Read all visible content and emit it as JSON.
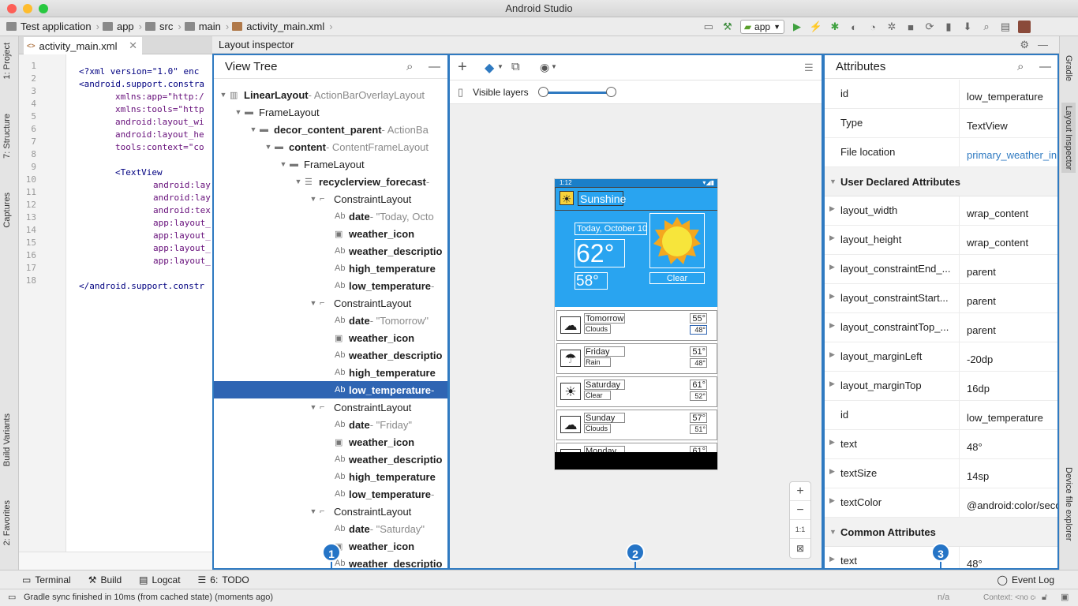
{
  "window": {
    "title": "Android Studio"
  },
  "breadcrumbs": [
    "Test application",
    "app",
    "src",
    "main",
    "activity_main.xml"
  ],
  "run_config": "app",
  "left_tabs": [
    "1: Project",
    "7: Structure",
    "Captures",
    "Build Variants",
    "2: Favorites"
  ],
  "right_tabs": [
    "Gradle",
    "Layout Inspector",
    "Device file explorer"
  ],
  "editor": {
    "tab": "activity_main.xml",
    "line_numbers": [
      "1",
      "2",
      "3",
      "4",
      "5",
      "6",
      "7",
      "8",
      "9",
      "10",
      "11",
      "12",
      "13",
      "14",
      "15",
      "16",
      "17",
      "18"
    ],
    "lines": [
      "<?xml version=\"1.0\" enc",
      "<android.support.constra",
      "xmlns:app=\"http:/",
      "xmlns:tools=\"http",
      "android:layout_wi",
      "android:layout_he",
      "tools:context=\"co",
      "",
      "<TextView",
      "android:lay",
      "android:lay",
      "android:tex",
      "app:layout_",
      "app:layout_",
      "app:layout_",
      "app:layout_",
      "",
      "</android.support.constr"
    ]
  },
  "inspector": {
    "title": "Layout inspector",
    "view_tree": {
      "title": "View Tree",
      "rows": [
        {
          "name": "LinearLayout",
          "suffix": " - ActionBarOverlayLayout",
          "indent": 0,
          "arrow": "▼",
          "icon": "▥",
          "bold": true
        },
        {
          "name": "FrameLayout",
          "suffix": "",
          "indent": 1,
          "arrow": "▼",
          "icon": "▬",
          "bold": false
        },
        {
          "name": "decor_content_parent",
          "suffix": " - ActionBa",
          "indent": 2,
          "arrow": "▼",
          "icon": "▬",
          "bold": true
        },
        {
          "name": "content",
          "suffix": " - ContentFrameLayout",
          "indent": 3,
          "arrow": "▼",
          "icon": "▬",
          "bold": true
        },
        {
          "name": "FrameLayout",
          "suffix": "",
          "indent": 4,
          "arrow": "▼",
          "icon": "▬",
          "bold": false
        },
        {
          "name": "recyclerview_forecast",
          "suffix": " - ",
          "indent": 5,
          "arrow": "▼",
          "icon": "☰",
          "bold": true
        },
        {
          "name": "ConstraintLayout",
          "suffix": "",
          "indent": 6,
          "arrow": "▼",
          "icon": "⌐",
          "bold": false
        },
        {
          "name": "date",
          "suffix": " - \"Today, Octo",
          "indent": 7,
          "arrow": "",
          "icon": "Ab",
          "bold": true
        },
        {
          "name": "weather_icon",
          "suffix": "",
          "indent": 7,
          "arrow": "",
          "icon": "▣",
          "bold": true
        },
        {
          "name": "weather_descriptio",
          "suffix": "",
          "indent": 7,
          "arrow": "",
          "icon": "Ab",
          "bold": true
        },
        {
          "name": "high_temperature",
          "suffix": "",
          "indent": 7,
          "arrow": "",
          "icon": "Ab",
          "bold": true
        },
        {
          "name": "low_temperature",
          "suffix": " -",
          "indent": 7,
          "arrow": "",
          "icon": "Ab",
          "bold": true
        },
        {
          "name": "ConstraintLayout",
          "suffix": "",
          "indent": 6,
          "arrow": "▼",
          "icon": "⌐",
          "bold": false
        },
        {
          "name": "date",
          "suffix": " - \"Tomorrow\"",
          "indent": 7,
          "arrow": "",
          "icon": "Ab",
          "bold": true
        },
        {
          "name": "weather_icon",
          "suffix": "",
          "indent": 7,
          "arrow": "",
          "icon": "▣",
          "bold": true
        },
        {
          "name": "weather_descriptio",
          "suffix": "",
          "indent": 7,
          "arrow": "",
          "icon": "Ab",
          "bold": true
        },
        {
          "name": "high_temperature",
          "suffix": "",
          "indent": 7,
          "arrow": "",
          "icon": "Ab",
          "bold": true
        },
        {
          "name": "low_temperature",
          "suffix": " -",
          "indent": 7,
          "arrow": "",
          "icon": "Ab",
          "bold": true,
          "selected": true
        },
        {
          "name": "ConstraintLayout",
          "suffix": "",
          "indent": 6,
          "arrow": "▼",
          "icon": "⌐",
          "bold": false
        },
        {
          "name": "date",
          "suffix": " - \"Friday\"",
          "indent": 7,
          "arrow": "",
          "icon": "Ab",
          "bold": true
        },
        {
          "name": "weather_icon",
          "suffix": "",
          "indent": 7,
          "arrow": "",
          "icon": "▣",
          "bold": true
        },
        {
          "name": "weather_descriptio",
          "suffix": "",
          "indent": 7,
          "arrow": "",
          "icon": "Ab",
          "bold": true
        },
        {
          "name": "high_temperature",
          "suffix": "",
          "indent": 7,
          "arrow": "",
          "icon": "Ab",
          "bold": true
        },
        {
          "name": "low_temperature",
          "suffix": " -",
          "indent": 7,
          "arrow": "",
          "icon": "Ab",
          "bold": true
        },
        {
          "name": "ConstraintLayout",
          "suffix": "",
          "indent": 6,
          "arrow": "▼",
          "icon": "⌐",
          "bold": false
        },
        {
          "name": "date",
          "suffix": " - \"Saturday\"",
          "indent": 7,
          "arrow": "",
          "icon": "Ab",
          "bold": true
        },
        {
          "name": "weather_icon",
          "suffix": "",
          "indent": 7,
          "arrow": "",
          "icon": "▣",
          "bold": true
        },
        {
          "name": "weather_descriptio",
          "suffix": "",
          "indent": 7,
          "arrow": "",
          "icon": "Ab",
          "bold": true
        }
      ]
    },
    "visible_layers_label": "Visible layers",
    "device": {
      "time": "1:12",
      "app_name": "Sunshine",
      "today_date": "Today, October 10",
      "today_high": "62°",
      "today_low": "58°",
      "today_desc": "Clear",
      "forecast": [
        {
          "day": "Tomorrow",
          "desc": "Clouds",
          "high": "55°",
          "low": "48°",
          "icon": "☁"
        },
        {
          "day": "Friday",
          "desc": "Rain",
          "high": "51°",
          "low": "48°",
          "icon": "☂"
        },
        {
          "day": "Saturday",
          "desc": "Clear",
          "high": "61°",
          "low": "52°",
          "icon": "☀"
        },
        {
          "day": "Sunday",
          "desc": "Clouds",
          "high": "57°",
          "low": "51°",
          "icon": "☁"
        },
        {
          "day": "Monday",
          "desc": "",
          "high": "61°",
          "low": "",
          "icon": "☀"
        }
      ]
    },
    "zoom_buttons": [
      "+",
      "−",
      "1:1",
      "⊠"
    ],
    "attributes": {
      "title": "Attributes",
      "rows": [
        {
          "kind": "attr",
          "key": "id",
          "value": "low_temperature"
        },
        {
          "kind": "attr",
          "key": "Type",
          "value": "TextView"
        },
        {
          "kind": "attr",
          "key": "File location",
          "value": "primary_weather_in",
          "link": true
        },
        {
          "kind": "section",
          "key": "User Declared Attributes"
        },
        {
          "kind": "attr",
          "key": "layout_width",
          "value": "wrap_content",
          "expand": true
        },
        {
          "kind": "attr",
          "key": "layout_height",
          "value": "wrap_content",
          "expand": true
        },
        {
          "kind": "attr",
          "key": "layout_constraintEnd_...",
          "value": "parent",
          "expand": true
        },
        {
          "kind": "attr",
          "key": "layout_constraintStart...",
          "value": "parent",
          "expand": true
        },
        {
          "kind": "attr",
          "key": "layout_constraintTop_...",
          "value": "parent",
          "expand": true
        },
        {
          "kind": "attr",
          "key": "layout_marginLeft",
          "value": "-20dp",
          "expand": true
        },
        {
          "kind": "attr",
          "key": "layout_marginTop",
          "value": "16dp",
          "expand": true
        },
        {
          "kind": "attr",
          "key": "id",
          "value": "low_temperature"
        },
        {
          "kind": "attr",
          "key": "text",
          "value": "48°",
          "expand": true
        },
        {
          "kind": "attr",
          "key": "textSize",
          "value": "14sp",
          "expand": true
        },
        {
          "kind": "attr",
          "key": "textColor",
          "value": "@android:color/seco",
          "expand": true
        },
        {
          "kind": "section",
          "key": "Common Attributes"
        },
        {
          "kind": "attr",
          "key": "text",
          "value": "48°",
          "expand": true
        }
      ]
    },
    "badges": [
      "1",
      "2",
      "3"
    ]
  },
  "bottom_tabs": [
    "Terminal",
    "Build",
    "Logcat",
    "TODO"
  ],
  "bottom_tab_prefix": "6:",
  "todo_prefix": "",
  "event_log": "Event Log",
  "status": {
    "message": "Gradle sync finished in 10ms (from cached state) (moments ago)",
    "na": "n/a",
    "context": "Context: <no context>"
  },
  "colors": {
    "accent": "#2f7ac1",
    "selection": "#2f65b3",
    "app_blue": "#29a4f0"
  }
}
